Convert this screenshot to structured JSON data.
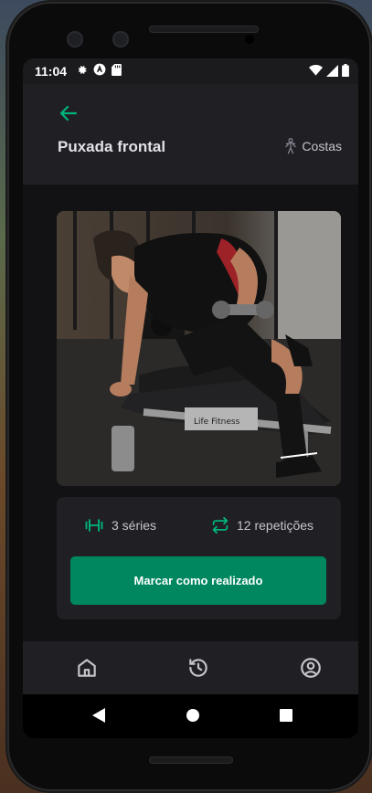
{
  "status_bar": {
    "time": "11:04",
    "icons_left": [
      "gear-icon",
      "a-circle-icon",
      "sd-card-icon"
    ],
    "icons_right": [
      "wifi-icon",
      "signal-icon",
      "battery-icon"
    ]
  },
  "header": {
    "back_icon": "arrow-left-icon",
    "title": "Puxada frontal",
    "group_icon": "body-icon",
    "group_label": "Costas"
  },
  "exercise": {
    "image_description": "man doing dumbbell row on a bench in a gym",
    "series_icon": "dumbbell-icon",
    "series": "3 séries",
    "reps_icon": "repeat-icon",
    "repetitions": "12 repetições",
    "done_button": "Marcar como realizado"
  },
  "tabs": [
    {
      "name": "home",
      "icon": "home-icon"
    },
    {
      "name": "history",
      "icon": "history-icon"
    },
    {
      "name": "profile",
      "icon": "user-circle-icon"
    }
  ],
  "colors": {
    "accent": "#00B37E",
    "button": "#00875F",
    "header_bg": "#202024",
    "content_bg": "#121214",
    "text": "#E1E1E6"
  }
}
